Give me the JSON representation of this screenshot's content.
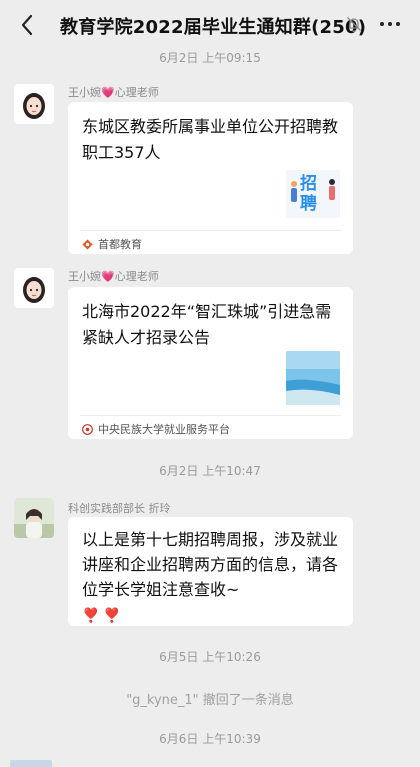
{
  "header": {
    "title": "教育学院2022届毕业生通知群(250)"
  },
  "timestamps": [
    "6月2日 上午09:15",
    "6月2日 上午10:47",
    "6月5日 上午10:26",
    "6月6日 上午10:39"
  ],
  "messages": [
    {
      "sender_name": "王小婉",
      "sender_role": "心理老师",
      "card_title": "东城区教委所属事业单位公开招聘教职工357人",
      "thumb_text": "招聘",
      "source_name": "首都教育"
    },
    {
      "sender_name": "王小婉",
      "sender_role": "心理老师",
      "card_title": "北海市2022年“智汇珠城”引进急需紧缺人才招录公告",
      "source_name": "中央民族大学就业服务平台"
    },
    {
      "sender_name": "科创实践部部长 折玲",
      "text": "以上是第十七期招聘周报，涉及就业讲座和企业招聘两方面的信息，请各位学长学姐注意查收~",
      "emoji": "❣️❣️"
    }
  ],
  "recall_notice": "\"g_kyne_1\" 撤回了一条消息"
}
